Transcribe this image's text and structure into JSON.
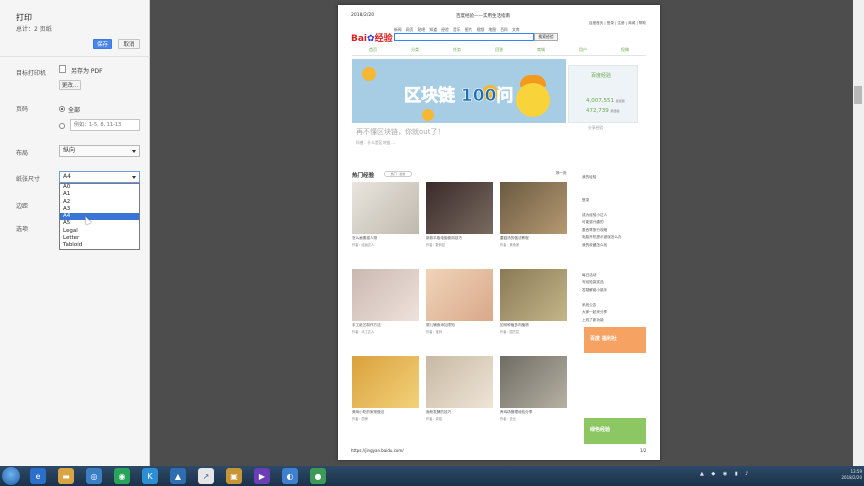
{
  "dialog": {
    "title": "打印",
    "total": "总计：2 页纸",
    "print_button": "保存",
    "cancel_button": "取消",
    "destination_label": "目标打印机",
    "destination_value": "另存为 PDF",
    "change_button": "更改...",
    "pages_label": "页码",
    "pages_all": "全部",
    "pages_range_placeholder": "例如：1-5, 8, 11-13",
    "layout_label": "布局",
    "layout_value": "纵向",
    "paper_label": "纸张尺寸",
    "paper_value": "A4",
    "margins_label": "边距",
    "options_label": "选项",
    "paper_options": [
      "A0",
      "A1",
      "A2",
      "A3",
      "A4",
      "A5",
      "Legal",
      "Letter",
      "Tabloid"
    ],
    "paper_selected_index": 4
  },
  "preview": {
    "date": "2018/2/20",
    "page_title": "百度经验——实用生活指南",
    "top_links": "百度首页 | 登录 | 注册 | 商城 | 帮助",
    "logo_left": "Bai",
    "logo_right": "经验",
    "nav_links": "新闻 网页 贴吧 知道 经验 音乐 图片 视频 地图 百科 文库",
    "search_button": "搜索经验",
    "categories": [
      "首页",
      "分类",
      "任务",
      "回答",
      "商城",
      "用户",
      "投稿"
    ],
    "banner_text": "区块链 100问",
    "side_title": "百度经验",
    "side_num1": "4,007,551",
    "side_num2": "472,739",
    "side_unit": "篇经验",
    "teaser": "再不懂区块链，你就out了！",
    "teaser_sub": "科普：什么是区块链 ...",
    "teaser_btn": "分享经验",
    "hot_title": "热门经验",
    "hot_tabs": "热门 · 最新",
    "hot_more": "换一批",
    "right_col": [
      "我的经验",
      "",
      "",
      "登录",
      "",
      "成为经验小达人",
      "可能感兴趣的",
      "墨西哥旅行攻略",
      "电脑开机提示错误怎么办",
      "我的收藏怎么找",
      "",
      "",
      "",
      "每日活动",
      "写经验赢奖品",
      "答疑解惑小能手",
      "",
      "系统公告",
      "大家一起来分享",
      "上线了新功能"
    ],
    "items": [
      {
        "t": "怎么画素描人物",
        "s": "作者：绘画达人"
      },
      {
        "t": "新款平板电脑使用技巧",
        "s": "作者：数码控"
      },
      {
        "t": "蘑菇汤的做法教程",
        "s": "作者：美食家"
      },
      {
        "t": "手工纸艺制作方法",
        "s": "作者：手工达人"
      },
      {
        "t": "婴儿辅食添加须知",
        "s": "作者：宝妈"
      },
      {
        "t": "如何种植多肉植物",
        "s": "作者：园艺控"
      },
      {
        "t": "美味小吃的家常做法",
        "s": "作者：厨房"
      },
      {
        "t": "面粉发酵的技巧",
        "s": "作者：烘焙"
      },
      {
        "t": "养鸡场管理经验分享",
        "s": "作者：农业"
      }
    ],
    "ad1": "百度 福利社",
    "ad2": "绿色经验",
    "url": "https://jingyan.baidu.com/",
    "page_num": "1/2"
  },
  "taskbar": {
    "time": "13:59",
    "date": "2018/2/20"
  },
  "colors": {
    "accent": "#4a86e8",
    "green": "#6aa84f",
    "taskbar": "#1b3149"
  }
}
